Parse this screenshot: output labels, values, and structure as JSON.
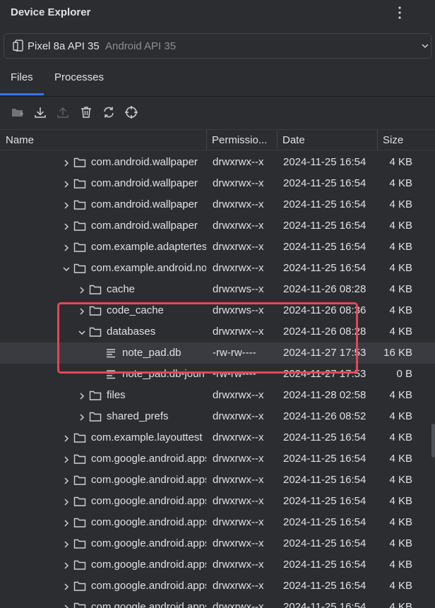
{
  "header": {
    "title": "Device Explorer",
    "menu_icon": "more-vert-icon"
  },
  "device": {
    "name": "Pixel 8a API 35",
    "api": "Android API 35",
    "icon": "device-icon"
  },
  "tabs": [
    {
      "label": "Files",
      "active": true
    },
    {
      "label": "Processes",
      "active": false
    }
  ],
  "toolbar": [
    "new-folder-icon",
    "download-icon",
    "upload-icon",
    "delete-icon",
    "sync-icon",
    "crosshair-icon"
  ],
  "columns": {
    "name": "Name",
    "permissions": "Permissio...",
    "date": "Date",
    "size": "Size"
  },
  "colors": {
    "accent": "#3574f0",
    "highlight_box": "#e44756",
    "selected_row": "#393b40"
  },
  "rows": [
    {
      "depth": 1,
      "expanded": false,
      "type": "folder",
      "name": "com.android.wallpaper",
      "permissions": "drwxrwx--x",
      "date": "2024-11-25 16:54",
      "size": "4 KB"
    },
    {
      "depth": 1,
      "expanded": false,
      "type": "folder",
      "name": "com.android.wallpaper",
      "permissions": "drwxrwx--x",
      "date": "2024-11-25 16:54",
      "size": "4 KB"
    },
    {
      "depth": 1,
      "expanded": false,
      "type": "folder",
      "name": "com.android.wallpaper",
      "permissions": "drwxrwx--x",
      "date": "2024-11-25 16:54",
      "size": "4 KB"
    },
    {
      "depth": 1,
      "expanded": false,
      "type": "folder",
      "name": "com.android.wallpaper",
      "permissions": "drwxrwx--x",
      "date": "2024-11-25 16:54",
      "size": "4 KB"
    },
    {
      "depth": 1,
      "expanded": false,
      "type": "folder",
      "name": "com.example.adaptertest",
      "permissions": "drwxrwx--x",
      "date": "2024-11-25 16:54",
      "size": "4 KB"
    },
    {
      "depth": 1,
      "expanded": true,
      "type": "folder",
      "name": "com.example.android.notepad",
      "permissions": "drwxrwx--x",
      "date": "2024-11-25 16:54",
      "size": "4 KB"
    },
    {
      "depth": 2,
      "expanded": false,
      "type": "folder",
      "name": "cache",
      "permissions": "drwxrws--x",
      "date": "2024-11-26 08:28",
      "size": "4 KB"
    },
    {
      "depth": 2,
      "expanded": false,
      "type": "folder",
      "name": "code_cache",
      "permissions": "drwxrws--x",
      "date": "2024-11-26 08:36",
      "size": "4 KB"
    },
    {
      "depth": 2,
      "expanded": true,
      "type": "folder",
      "name": "databases",
      "permissions": "drwxrwx--x",
      "date": "2024-11-26 08:28",
      "size": "4 KB"
    },
    {
      "depth": 3,
      "expanded": false,
      "type": "file",
      "name": "note_pad.db",
      "permissions": "-rw-rw----",
      "date": "2024-11-27 17:53",
      "size": "16 KB",
      "selected": true
    },
    {
      "depth": 3,
      "expanded": false,
      "type": "file",
      "name": "note_pad.db-journal",
      "permissions": "-rw-rw----",
      "date": "2024-11-27 17:53",
      "size": "0 B"
    },
    {
      "depth": 2,
      "expanded": false,
      "type": "folder",
      "name": "files",
      "permissions": "drwxrwx--x",
      "date": "2024-11-28 02:58",
      "size": "4 KB"
    },
    {
      "depth": 2,
      "expanded": false,
      "type": "folder",
      "name": "shared_prefs",
      "permissions": "drwxrwx--x",
      "date": "2024-11-26 08:52",
      "size": "4 KB"
    },
    {
      "depth": 1,
      "expanded": false,
      "type": "folder",
      "name": "com.example.layouttest",
      "permissions": "drwxrwx--x",
      "date": "2024-11-25 16:54",
      "size": "4 KB"
    },
    {
      "depth": 1,
      "expanded": false,
      "type": "folder",
      "name": "com.google.android.apps",
      "permissions": "drwxrwx--x",
      "date": "2024-11-25 16:54",
      "size": "4 KB"
    },
    {
      "depth": 1,
      "expanded": false,
      "type": "folder",
      "name": "com.google.android.apps",
      "permissions": "drwxrwx--x",
      "date": "2024-11-25 16:54",
      "size": "4 KB"
    },
    {
      "depth": 1,
      "expanded": false,
      "type": "folder",
      "name": "com.google.android.apps",
      "permissions": "drwxrwx--x",
      "date": "2024-11-25 16:54",
      "size": "4 KB"
    },
    {
      "depth": 1,
      "expanded": false,
      "type": "folder",
      "name": "com.google.android.apps",
      "permissions": "drwxrwx--x",
      "date": "2024-11-25 16:54",
      "size": "4 KB"
    },
    {
      "depth": 1,
      "expanded": false,
      "type": "folder",
      "name": "com.google.android.apps",
      "permissions": "drwxrwx--x",
      "date": "2024-11-25 16:54",
      "size": "4 KB"
    },
    {
      "depth": 1,
      "expanded": false,
      "type": "folder",
      "name": "com.google.android.apps",
      "permissions": "drwxrwx--x",
      "date": "2024-11-25 16:54",
      "size": "4 KB"
    },
    {
      "depth": 1,
      "expanded": false,
      "type": "folder",
      "name": "com.google.android.apps",
      "permissions": "drwxrwx--x",
      "date": "2024-11-25 16:54",
      "size": "4 KB"
    },
    {
      "depth": 1,
      "expanded": false,
      "type": "folder",
      "name": "com.google.android.apps",
      "permissions": "drwxrwx--x",
      "date": "2024-11-25 16:54",
      "size": "4 KB"
    }
  ]
}
